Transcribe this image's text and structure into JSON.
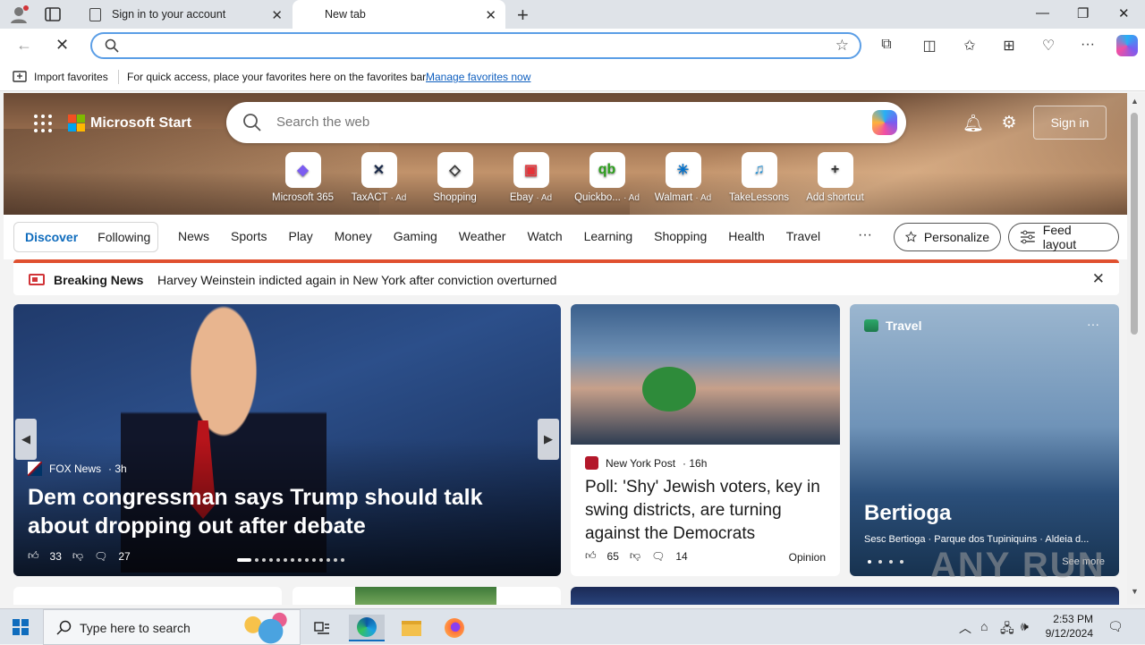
{
  "browser": {
    "tabs": [
      {
        "label": "Sign in to your account"
      },
      {
        "label": "New tab"
      }
    ],
    "address": {
      "placeholder": ""
    },
    "favorites_bar": {
      "import_label": "Import favorites",
      "message": "For quick access, place your favorites here on the favorites bar.",
      "link": "Manage favorites now"
    }
  },
  "header": {
    "brand": "Microsoft Start",
    "search_placeholder": "Search the web",
    "signin_label": "Sign in"
  },
  "shortcuts": [
    {
      "label": "Microsoft 365",
      "ad": "",
      "icon": "m365-icon",
      "glyph": "◆",
      "color": "#7b5cf0"
    },
    {
      "label": "TaxACT",
      "ad": "· Ad",
      "icon": "taxact-icon",
      "glyph": "✕",
      "color": "#1a2a4a"
    },
    {
      "label": "Shopping",
      "ad": "",
      "icon": "shopping-tag-icon",
      "glyph": "◇",
      "color": "#333333"
    },
    {
      "label": "Ebay",
      "ad": "· Ad",
      "icon": "ebay-bag-icon",
      "glyph": "▣",
      "color": "#e53238"
    },
    {
      "label": "Quickbo...",
      "ad": "· Ad",
      "icon": "quickbooks-icon",
      "glyph": "qb",
      "color": "#2ca01c"
    },
    {
      "label": "Walmart",
      "ad": "· Ad",
      "icon": "walmart-icon",
      "glyph": "✳",
      "color": "#0071ce"
    },
    {
      "label": "TakeLessons",
      "ad": "",
      "icon": "takelessons-icon",
      "glyph": "♫",
      "color": "#1f8fd6"
    },
    {
      "label": "Add shortcut",
      "ad": "",
      "icon": "plus-icon",
      "glyph": "+",
      "color": "#333333"
    }
  ],
  "nav": {
    "discover": "Discover",
    "following": "Following",
    "items": [
      "News",
      "Sports",
      "Play",
      "Money",
      "Gaming",
      "Weather",
      "Watch",
      "Learning",
      "Shopping",
      "Health",
      "Travel"
    ],
    "more": "···",
    "personalize": "Personalize",
    "feed_layout": "Feed layout"
  },
  "breaking": {
    "label": "Breaking News",
    "headline": "Harvey Weinstein indicted again in New York after conviction overturned"
  },
  "main_story": {
    "source": "FOX News",
    "age": "· 3h",
    "title": "Dem congressman says Trump should talk about dropping out after debate",
    "likes": "33",
    "comments": "27"
  },
  "poll_story": {
    "source": "New York Post",
    "age": "· 16h",
    "title": "Poll: 'Shy' Jewish voters, key in swing districts, are turning against the Democrats",
    "likes": "65",
    "comments": "14",
    "tag": "Opinion"
  },
  "travel_card": {
    "category": "Travel",
    "more": "···",
    "title": "Bertioga",
    "subtitle": "Sesc Bertioga · Parque dos Tupiniquins · Aldeia d...",
    "see_more": "See more"
  },
  "watermark": "ANY RUN",
  "taskbar": {
    "search_placeholder": "Type here to search",
    "time": "2:53 PM",
    "date": "9/12/2024"
  }
}
